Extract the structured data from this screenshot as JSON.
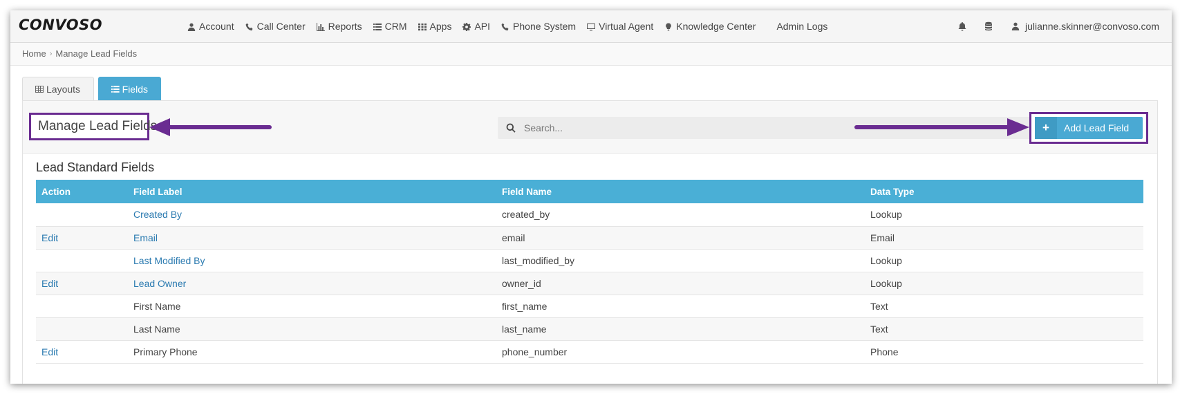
{
  "app": {
    "logo": "CONVOSO"
  },
  "nav": {
    "items": [
      {
        "label": "Account",
        "icon": "user-icon"
      },
      {
        "label": "Call Center",
        "icon": "phone-icon"
      },
      {
        "label": "Reports",
        "icon": "bar-chart-icon"
      },
      {
        "label": "CRM",
        "icon": "list-icon"
      },
      {
        "label": "Apps",
        "icon": "grid-icon"
      },
      {
        "label": "API",
        "icon": "gear-icon"
      },
      {
        "label": "Phone System",
        "icon": "phone-icon"
      },
      {
        "label": "Virtual Agent",
        "icon": "monitor-icon"
      },
      {
        "label": "Knowledge Center",
        "icon": "lightbulb-icon"
      },
      {
        "label": "Admin Logs",
        "icon": ""
      }
    ],
    "user_email": "julianne.skinner@convoso.com"
  },
  "breadcrumb": {
    "home": "Home",
    "current": "Manage Lead Fields"
  },
  "tabs": [
    {
      "label": "Layouts",
      "icon": "table-icon"
    },
    {
      "label": "Fields",
      "icon": "list-icon",
      "active": true
    }
  ],
  "header": {
    "title": "Manage Lead Fields",
    "search_placeholder": "Search...",
    "add_button_label": "Add Lead Field",
    "add_button_icon": "+"
  },
  "section": {
    "title": "Lead Standard Fields",
    "columns": [
      "Action",
      "Field Label",
      "Field Name",
      "Data Type"
    ],
    "rows": [
      {
        "action": "",
        "label": "Created By",
        "label_link": true,
        "name": "created_by",
        "type": "Lookup"
      },
      {
        "action": "Edit",
        "label": "Email",
        "label_link": true,
        "name": "email",
        "type": "Email"
      },
      {
        "action": "",
        "label": "Last Modified By",
        "label_link": true,
        "name": "last_modified_by",
        "type": "Lookup"
      },
      {
        "action": "Edit",
        "label": "Lead Owner",
        "label_link": true,
        "name": "owner_id",
        "type": "Lookup"
      },
      {
        "action": "",
        "label": "First Name",
        "label_link": false,
        "name": "first_name",
        "type": "Text"
      },
      {
        "action": "",
        "label": "Last Name",
        "label_link": false,
        "name": "last_name",
        "type": "Text"
      },
      {
        "action": "Edit",
        "label": "Primary Phone",
        "label_link": false,
        "name": "phone_number",
        "type": "Phone"
      }
    ]
  },
  "colors": {
    "accent": "#4aafd6",
    "annotation": "#6a2c91",
    "link": "#2a7ab0"
  }
}
